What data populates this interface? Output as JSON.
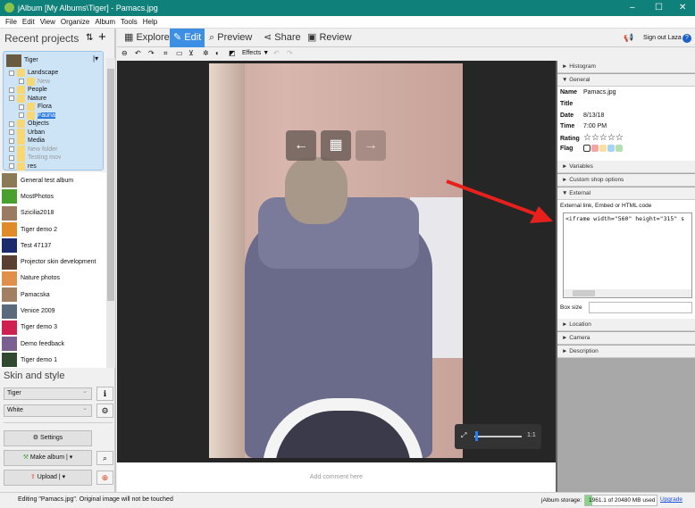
{
  "window": {
    "title": "jAlbum [My Albums\\Tiger] - Pamacs.jpg",
    "minimize": "–",
    "maximize": "☐",
    "close": "✕"
  },
  "menu": [
    "File",
    "Edit",
    "View",
    "Organize",
    "Album",
    "Tools",
    "Help"
  ],
  "left": {
    "title": "Recent projects",
    "sort_icon": "⇅",
    "add_icon": "+",
    "current_project": "Tiger",
    "tree": [
      {
        "label": "Landscape",
        "lvl": 0,
        "y": 0
      },
      {
        "label": "New",
        "lvl": 1,
        "y": 1,
        "dim": true
      },
      {
        "label": "People",
        "lvl": 0,
        "y": 2
      },
      {
        "label": "Nature",
        "lvl": 0,
        "y": 3
      },
      {
        "label": "Flora",
        "lvl": 1,
        "y": 4
      },
      {
        "label": "Fauna",
        "lvl": 1,
        "y": 5,
        "selected": true
      },
      {
        "label": "Objects",
        "lvl": 0,
        "y": 6
      },
      {
        "label": "Urban",
        "lvl": 0,
        "y": 7
      },
      {
        "label": "Media",
        "lvl": 0,
        "y": 8
      },
      {
        "label": "New folder",
        "lvl": 0,
        "y": 9,
        "dim": true
      },
      {
        "label": "Testing mov",
        "lvl": 0,
        "y": 10,
        "dim": true
      },
      {
        "label": "res",
        "lvl": 0,
        "y": 11
      }
    ],
    "projects": [
      {
        "label": "General test album",
        "c": "#8a7a55"
      },
      {
        "label": "MostPhotos",
        "c": "#4aa02c"
      },
      {
        "label": "Szicilia2018",
        "c": "#9a7a60"
      },
      {
        "label": "Tiger demo 2",
        "c": "#e08a2a"
      },
      {
        "label": "Test 47137",
        "c": "#1a2a6a"
      },
      {
        "label": "Projector skin development",
        "c": "#5a4030"
      },
      {
        "label": "Nature photos",
        "c": "#e0904a"
      },
      {
        "label": "Pamacska",
        "c": "#a08060"
      },
      {
        "label": "Venice 2009",
        "c": "#5a6a7a"
      },
      {
        "label": "Tiger demo 3",
        "c": "#d02050"
      },
      {
        "label": "Demo feedback",
        "c": "#7a6090"
      },
      {
        "label": "Tiger demo 1",
        "c": "#304a30"
      }
    ],
    "skin_title": "Skin and style",
    "skin": "Tiger",
    "style": "White",
    "settings": "Settings",
    "make_album": "Make album",
    "upload": "Upload"
  },
  "tabs": [
    {
      "label": "Explore",
      "icon": "▦"
    },
    {
      "label": "Edit",
      "icon": "✎"
    },
    {
      "label": "Preview",
      "icon": "🔍"
    },
    {
      "label": "Share",
      "icon": "<"
    },
    {
      "label": "Review",
      "icon": "▣"
    }
  ],
  "header_right": {
    "sign_out": "Sign out Laza",
    "help": "?"
  },
  "edit_toolbar": {
    "effects": "Effects ▼"
  },
  "viewer": {
    "zoom_label": "1:1",
    "zoom_value": 0.02,
    "comment_placeholder": "Add comment here"
  },
  "right": {
    "histogram": "Histogram",
    "general": "General",
    "fields": [
      {
        "k": "Name",
        "v": "Pamacs.jpg"
      },
      {
        "k": "Title",
        "v": ""
      },
      {
        "k": "Date",
        "v": "8/13/18"
      },
      {
        "k": "Time",
        "v": "7:00 PM"
      }
    ],
    "rating_label": "Rating",
    "rating": "☆☆☆☆☆",
    "flag_label": "Flag",
    "flag_colors": [
      "#ffffff",
      "#f4a6a6",
      "#f8e0a0",
      "#a8d4f4",
      "#b4e0b0"
    ],
    "variables": "Variables",
    "custom_shop": "Custom shop options",
    "external": "External",
    "external_label": "External link, Embed or HTML code",
    "external_code": "<iframe width=\"560\" height=\"315\" s",
    "box_size": "Box size",
    "location": "Location",
    "camera": "Camera",
    "description": "Description"
  },
  "status": {
    "text": "Editing \"Pamacs.jpg\". Original image will not be touched",
    "storage_label": "jAlbum storage:",
    "storage": "1961.1 of 20480 MB used",
    "storage_fraction": 0.096,
    "upgrade": "Upgrade"
  }
}
